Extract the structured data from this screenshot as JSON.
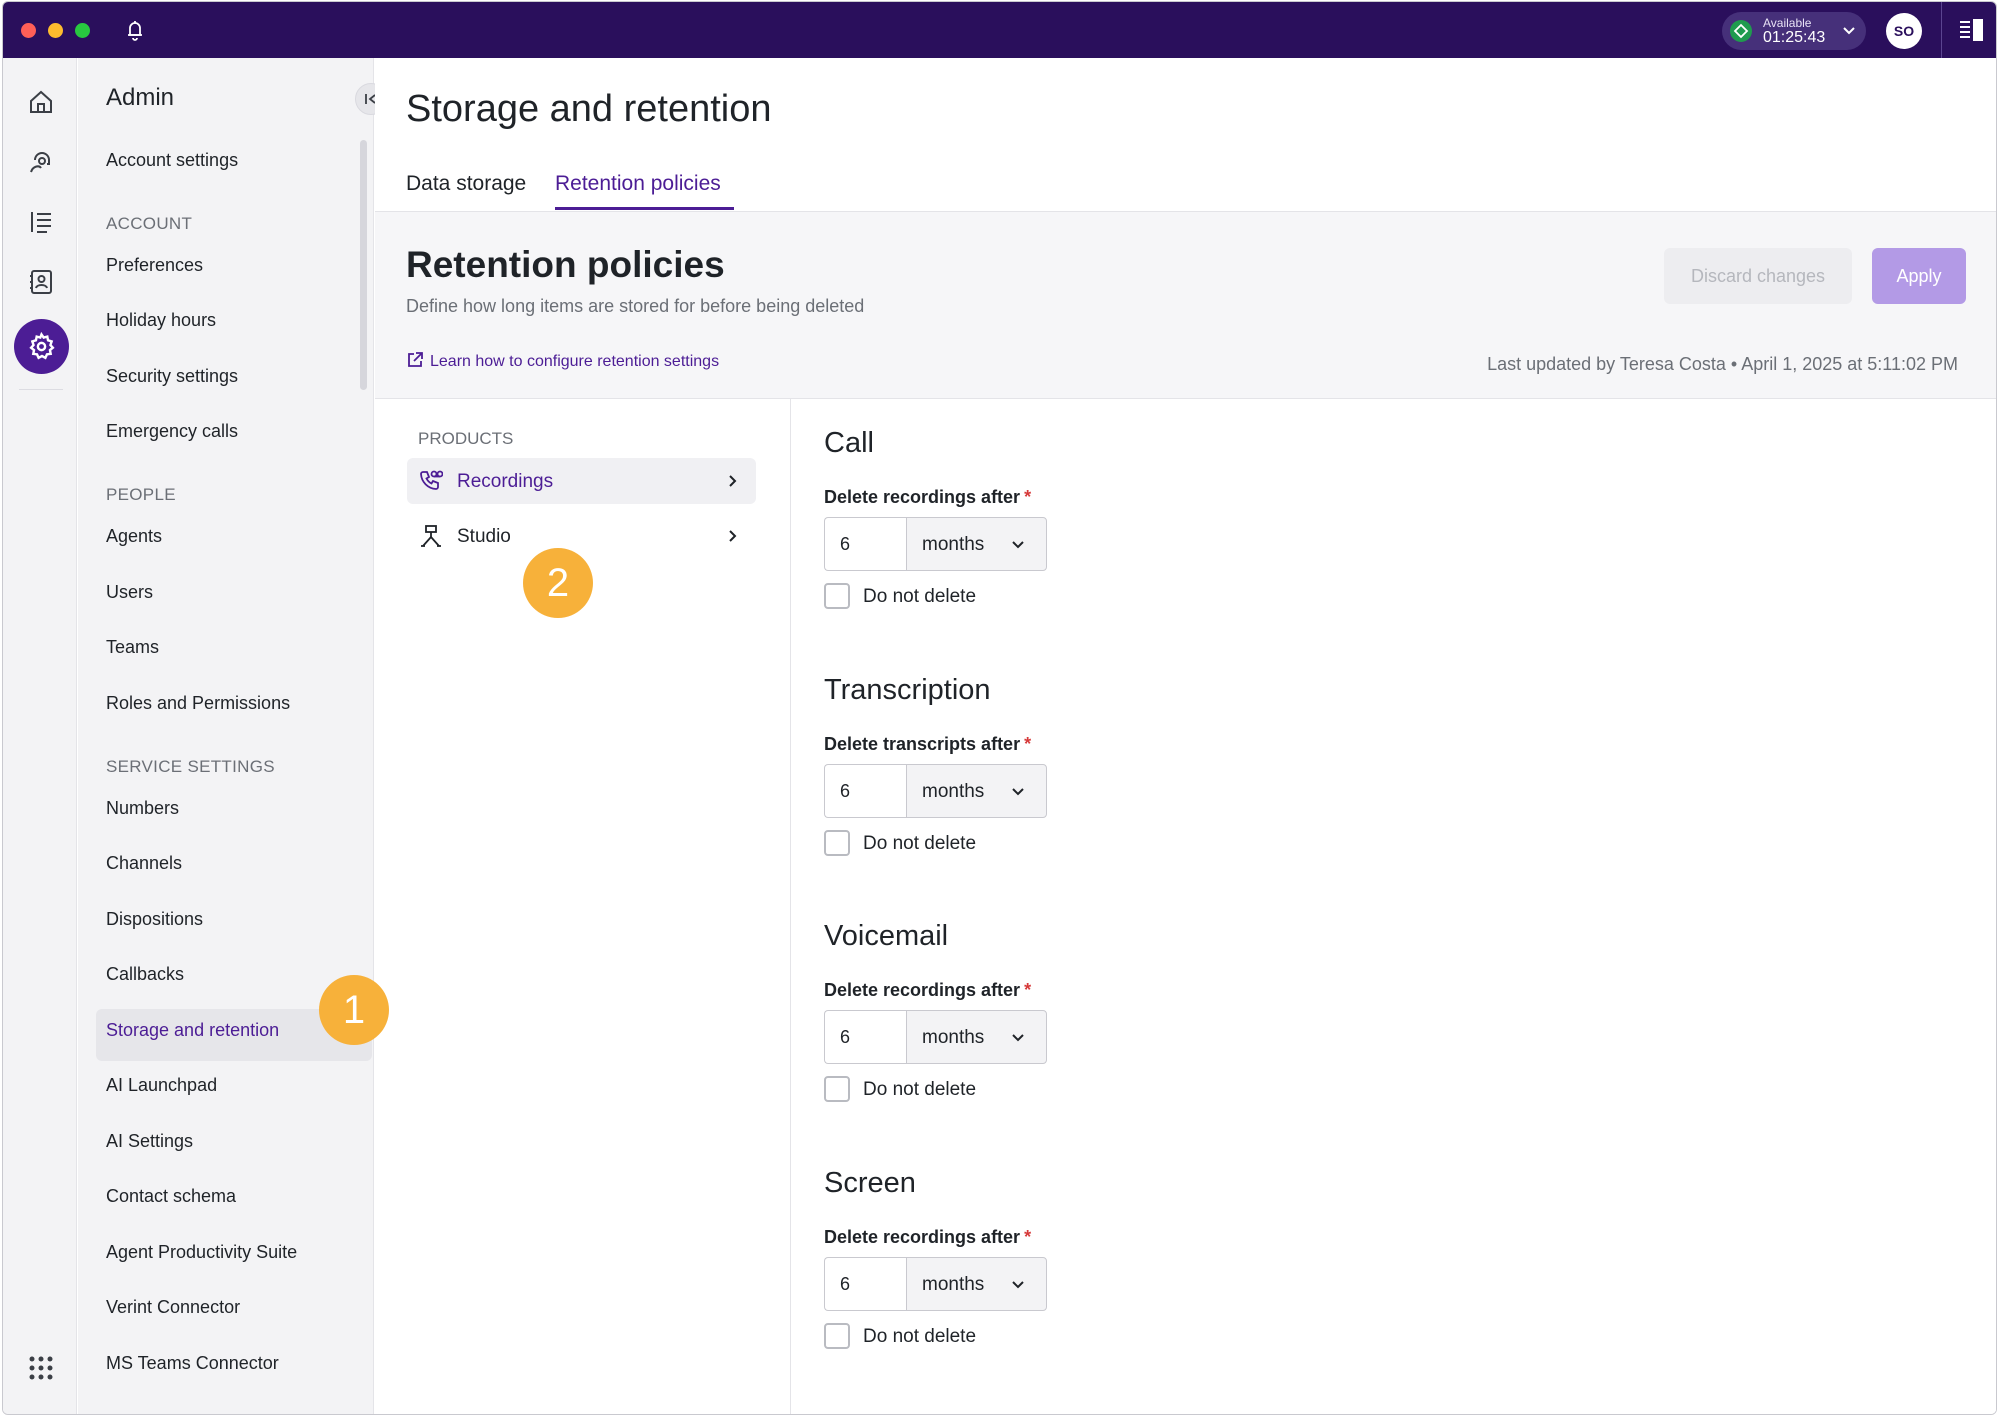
{
  "titlebar": {
    "status_label": "Available",
    "status_time": "01:25:43",
    "avatar_initials": "SO",
    "bar_color": "#2a0f5c"
  },
  "rail": {
    "icons": [
      "home-icon",
      "customer-support-icon",
      "list-icon",
      "contacts-icon",
      "settings-icon"
    ],
    "active": "settings-icon"
  },
  "sidebar": {
    "title": "Admin",
    "items_top": [
      "Account settings"
    ],
    "account": {
      "header": "ACCOUNT",
      "items": [
        "Preferences",
        "Holiday hours",
        "Security settings",
        "Emergency calls"
      ]
    },
    "people": {
      "header": "PEOPLE",
      "items": [
        "Agents",
        "Users",
        "Teams",
        "Roles and Permissions"
      ]
    },
    "service": {
      "header": "SERVICE SETTINGS",
      "items": [
        "Numbers",
        "Channels",
        "Dispositions",
        "Callbacks",
        "Storage and retention",
        "AI Launchpad",
        "AI Settings",
        "Contact schema",
        "Agent Productivity Suite",
        "Verint Connector",
        "MS Teams Connector"
      ]
    },
    "active_item": "Storage and retention"
  },
  "badges": {
    "one": "1",
    "two": "2"
  },
  "main": {
    "page_title": "Storage and retention",
    "tabs": [
      {
        "label": "Data storage"
      },
      {
        "label": "Retention policies"
      }
    ],
    "active_tab": "Retention policies",
    "section_title": "Retention policies",
    "section_subtitle": "Define how long items are stored for before being deleted",
    "learn_link": "Learn how to configure retention settings",
    "last_updated": "Last updated by Teresa Costa • April 1, 2025 at 5:11:02 PM",
    "discard_label": "Discard changes",
    "apply_label": "Apply"
  },
  "products": {
    "header": "PRODUCTS",
    "items": [
      {
        "label": "Recordings",
        "icon": "phone-recording-icon"
      },
      {
        "label": "Studio",
        "icon": "flow-icon"
      }
    ],
    "active": "Recordings"
  },
  "policies": [
    {
      "title": "Call",
      "field_label": "Delete recordings after",
      "value": "6",
      "unit": "months",
      "do_not_delete": "Do not delete",
      "required_mark": "*"
    },
    {
      "title": "Transcription",
      "field_label": "Delete transcripts after",
      "value": "6",
      "unit": "months",
      "do_not_delete": "Do not delete",
      "required_mark": "*"
    },
    {
      "title": "Voicemail",
      "field_label": "Delete recordings after",
      "value": "6",
      "unit": "months",
      "do_not_delete": "Do not delete",
      "required_mark": "*"
    },
    {
      "title": "Screen",
      "field_label": "Delete recordings after",
      "value": "6",
      "unit": "months",
      "do_not_delete": "Do not delete",
      "required_mark": "*"
    }
  ],
  "colors": {
    "accent": "#4c1d95",
    "badge": "#f7b13a",
    "apply_disabled": "#b39ae6"
  }
}
